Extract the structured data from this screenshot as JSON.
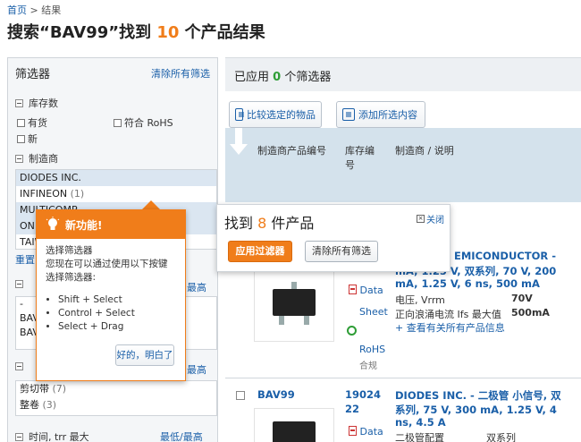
{
  "breadcrumb": {
    "home": "首页",
    "sep": ">",
    "current": "结果"
  },
  "title": {
    "pre": "搜索“BAV99”找到 ",
    "count": "10",
    "post": " 个产品结果"
  },
  "filters": {
    "heading": "筛选器",
    "clear_all": "清除所有筛选",
    "stock_section": "库存数",
    "in_stock": "有货",
    "rohs": "符合 RoHS",
    "new": "新",
    "mfr_section": "制造商",
    "manufacturers": [
      {
        "name": "DIODES INC.",
        "count": ""
      },
      {
        "name": "INFINEON",
        "count": "(1)"
      },
      {
        "name": "MULTICOMP",
        "count": ""
      },
      {
        "name": "ON",
        "count": ""
      },
      {
        "name": "TAIW",
        "count": ""
      }
    ],
    "reset": "重置",
    "high1": "最高",
    "pkg_items": [
      "-",
      "BAV",
      "BAV"
    ],
    "high2": "最高",
    "pack_items": [
      {
        "name": "剪切带",
        "count": "(7)"
      },
      {
        "name": "整卷",
        "count": "(3)"
      }
    ],
    "time_label": "时间, trr 最大",
    "time_range": "最低/最高"
  },
  "applied": {
    "pre": "已应用 ",
    "count": "0",
    "post": " 个筛选器"
  },
  "toolbar": {
    "compare": "比较选定的物品",
    "add_selected": "添加所选内容"
  },
  "table_head": {
    "mfr_part": "制造商产品编号",
    "stock_no": "库存编\n号",
    "mfr_desc": "制造商 / 说明"
  },
  "results_popup": {
    "pre": "找到 ",
    "count": "8",
    "post": " 件产品",
    "close": "关闭",
    "apply": "应用过滤器",
    "clear": "清除所有筛选"
  },
  "tip": {
    "title": "新功能!",
    "line1": "选择筛选器",
    "line2": "您现在可以通过使用以下按键选择筛选器:",
    "keys": [
      "Shift + Select",
      "Control + Select",
      "Select + Drag"
    ],
    "ok": "好的，明白了"
  },
  "products": [
    {
      "desc_line1": "EMICONDUCTOR -",
      "desc_line2": "mA, 1.25 V, 双系列, 70 V, 200",
      "desc_line3": "mA, 1.25 V, 6 ns, 500 mA",
      "spec1_label": "电压, Vrrm",
      "spec1_value": "70V",
      "spec2_label": "正向浪涌电流 Ifs 最大值",
      "spec2_value": "500mA",
      "all_info": "+ 查看有关所有产品信息",
      "data": "Data",
      "sheet": "Sheet",
      "rohs": "RoHS",
      "rohs_sub": "合规"
    },
    {
      "part": "BAV99",
      "stock_line1": "19024",
      "stock_line2": "22",
      "desc_line1": "DIODES INC. - 二极管 小信号, 双",
      "desc_line2": "系列, 75 V, 300 mA, 1.25 V, 4",
      "desc_line3": "ns, 4.5 A",
      "spec1_label": "二极管配置",
      "spec1_value": "双系列",
      "data": "Data"
    }
  ]
}
